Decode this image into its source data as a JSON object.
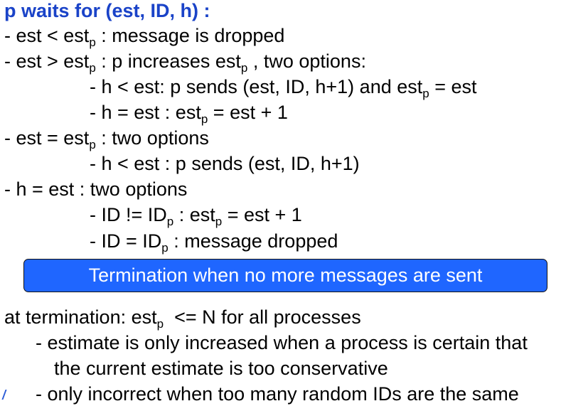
{
  "title": "p waits for (est, ID, h) :",
  "lines": [
    {
      "pre": "- est < est",
      "sub1": "p",
      "mid": " : message is dropped",
      "sub2": "",
      "post": ""
    },
    {
      "pre": "- est > est",
      "sub1": "p",
      "mid": " : p increases est",
      "sub2": "p",
      "post": " , two options:"
    },
    {
      "pre": "- h < est: p sends (est, ID, h+1) and est",
      "sub1": "p",
      "mid": " = est",
      "sub2": "",
      "post": ""
    },
    {
      "pre": "- h = est : est",
      "sub1": "p",
      "mid": " = est + 1",
      "sub2": "",
      "post": ""
    },
    {
      "pre": "- est = est",
      "sub1": "p",
      "mid": " : two options",
      "sub2": "",
      "post": ""
    },
    {
      "pre": "- h < est : p sends (est, ID, h+1)",
      "sub1": "",
      "mid": "",
      "sub2": "",
      "post": ""
    },
    {
      "pre": "- h = est : two options",
      "sub1": "",
      "mid": "",
      "sub2": "",
      "post": ""
    },
    {
      "pre": "- ID != ID",
      "sub1": "p",
      "mid": " : est",
      "sub2": "p",
      "post": " = est + 1"
    },
    {
      "pre": "- ID = ID",
      "sub1": "p",
      "mid": " : message dropped",
      "sub2": "",
      "post": ""
    }
  ],
  "banner": "Termination when no more messages are sent",
  "termination": {
    "pre": "at termination: est",
    "sub1": "p",
    "post": "  <= N for all processes"
  },
  "bullets": [
    "- estimate is only increased when a process is certain that",
    "the current estimate is too conservative",
    "- only incorrect when too many random IDs are the same"
  ]
}
